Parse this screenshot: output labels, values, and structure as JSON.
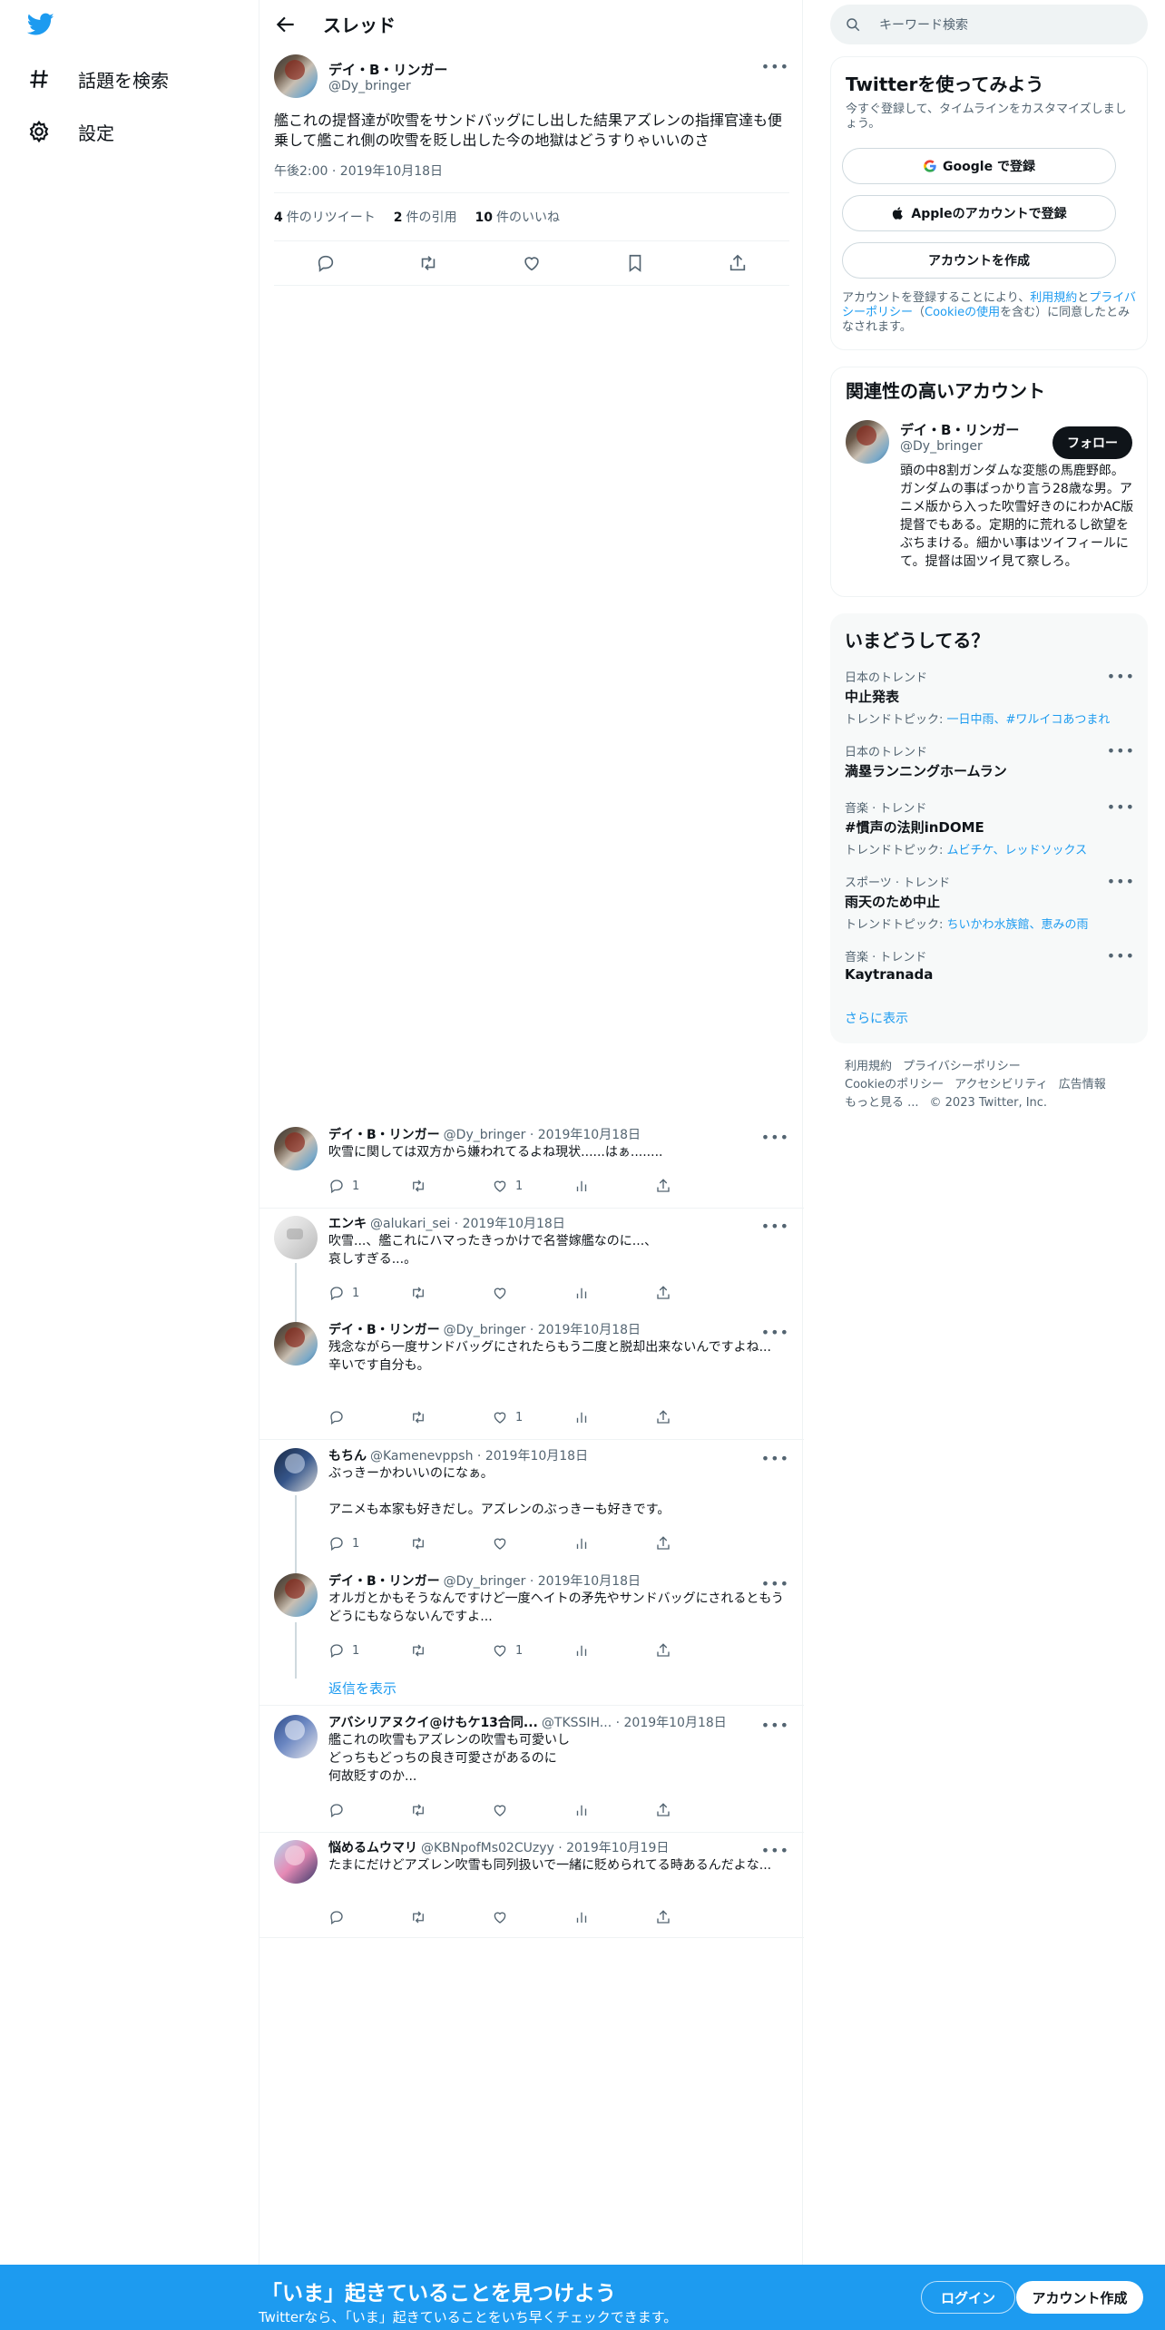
{
  "nav": {
    "logo_icon": "twitter-bird-icon",
    "explore_label": "話題を検索",
    "settings_label": "設定"
  },
  "header": {
    "title": "スレッド"
  },
  "main_tweet": {
    "name": "デイ・B・リンガー",
    "handle": "@Dy_bringer",
    "text": "艦これの提督達が吹雪をサンドバッグにし出した結果アズレンの指揮官達も便乗して艦これ側の吹雪を貶し出した今の地獄はどうすりゃいいのさ",
    "time": "午後2:00 · 2019年10月18日",
    "retweets_count": "4",
    "retweets_label": "件のリツイート",
    "quotes_count": "2",
    "quotes_label": "件の引用",
    "likes_count": "10",
    "likes_label": "件のいいね"
  },
  "replies": [
    {
      "name": "デイ・B・リンガー",
      "handle": "@Dy_bringer · 2019年10月18日",
      "text": "吹雪に関しては双方から嫌われてるよね現状......はぁ........",
      "reply_count": "1",
      "retweet_count": "",
      "like_count": "1"
    },
    {
      "name": "エンキ",
      "handle": "@alukari_sei · 2019年10月18日",
      "text": "吹雪...、艦これにハマったきっかけで名誉嫁艦なのに...、\n哀しすぎる...。",
      "reply_count": "1",
      "retweet_count": "",
      "like_count": ""
    },
    {
      "name": "デイ・B・リンガー",
      "handle": "@Dy_bringer · 2019年10月18日",
      "text": "残念ながら一度サンドバッグにされたらもう二度と脱却出来ないんですよね...\n辛いです自分も。",
      "reply_count": "",
      "retweet_count": "",
      "like_count": "1"
    },
    {
      "name": "もちん",
      "handle": "@Kamenevppsh · 2019年10月18日",
      "text": "ぶっきーかわいいのになぁ。\n\nアニメも本家も好きだし。アズレンのぶっきーも好きです。",
      "reply_count": "1",
      "retweet_count": "",
      "like_count": ""
    },
    {
      "name": "デイ・B・リンガー",
      "handle": "@Dy_bringer · 2019年10月18日",
      "text": "オルガとかもそうなんですけど一度ヘイトの矛先やサンドバッグにされるともうどうにもならないんですよ...",
      "reply_count": "1",
      "retweet_count": "",
      "like_count": "1"
    },
    {
      "name": "アバシリアヌクイ@けもケ13合同...",
      "handle": "@TKSSIH... · 2019年10月18日",
      "text": "艦これの吹雪もアズレンの吹雪も可愛いし\nどっちもどっちの良き可愛さがあるのに\n何故貶すのか...",
      "reply_count": "",
      "retweet_count": "",
      "like_count": ""
    },
    {
      "name": "悩めるムウマリ",
      "handle": "@KBNpofMs02CUzyy · 2019年10月19日",
      "text": "たまにだけどアズレン吹雪も同列扱いで一緒に貶められてる時あるんだよな...",
      "reply_count": "",
      "retweet_count": "",
      "like_count": ""
    }
  ],
  "show_replies": "返信を表示",
  "search": {
    "placeholder": "キーワード検索"
  },
  "signup_card": {
    "title": "Twitterを使ってみよう",
    "subtitle": "今すぐ登録して、タイムラインをカスタマイズしましょう。",
    "google_label": "Google で登録",
    "apple_label": "Appleのアカウントで登録",
    "create_label": "アカウントを作成",
    "terms_prefix": "アカウントを登録することにより、",
    "terms_link": "利用規約",
    "terms_and": "と",
    "privacy_link": "プライバシーポリシー",
    "cookie_prefix": "（",
    "cookie_link": "Cookieの使用",
    "terms_suffix": "を含む）に同意したとみなされます。"
  },
  "related": {
    "title": "関連性の高いアカウント",
    "name": "デイ・B・リンガー",
    "handle": "@Dy_bringer",
    "follow_label": "フォロー",
    "bio": "頭の中8割ガンダムな変態の馬鹿野郎。ガンダムの事ばっかり言う28歳な男。アニメ版から入った吹雪好きのにわかAC版提督でもある。定期的に荒れるし欲望をぶちまける。細かい事はツイフィールにて。提督は固ツイ見て察しろ。"
  },
  "trends": {
    "title": "いまどうしてる？",
    "items": [
      {
        "context": "日本のトレンド",
        "name": "中止発表",
        "topics_prefix": "トレンドトピック: ",
        "topics": "一日中雨、#ワルイコあつまれ"
      },
      {
        "context": "日本のトレンド",
        "name": "満塁ランニングホームラン",
        "topics_prefix": "",
        "topics": ""
      },
      {
        "context": "音楽 · トレンド",
        "name": "#慣声の法則inDOME",
        "topics_prefix": "トレンドトピック: ",
        "topics": "ムビチケ、レッドソックス"
      },
      {
        "context": "スポーツ · トレンド",
        "name": "雨天のため中止",
        "topics_prefix": "トレンドトピック: ",
        "topics": "ちいかわ水族館、恵みの雨"
      },
      {
        "context": "音楽 · トレンド",
        "name": "Kaytranada",
        "topics_prefix": "",
        "topics": ""
      }
    ],
    "show_more": "さらに表示"
  },
  "footer": {
    "terms": "利用規約",
    "privacy": "プライバシーポリシー",
    "cookie": "Cookieのポリシー",
    "accessibility": "アクセシビリティ",
    "ads": "広告情報",
    "more": "もっと見る ...",
    "copyright": "© 2023 Twitter, Inc."
  },
  "bottom_bar": {
    "title": "「いま」起きていることを見つけよう",
    "subtitle": "Twitterなら、「いま」起きていることをいち早くチェックできます。",
    "login_label": "ログイン",
    "signup_label": "アカウント作成"
  },
  "colors": {
    "accent": "#1d9bf0",
    "text": "#0f1419",
    "muted": "#536471"
  }
}
